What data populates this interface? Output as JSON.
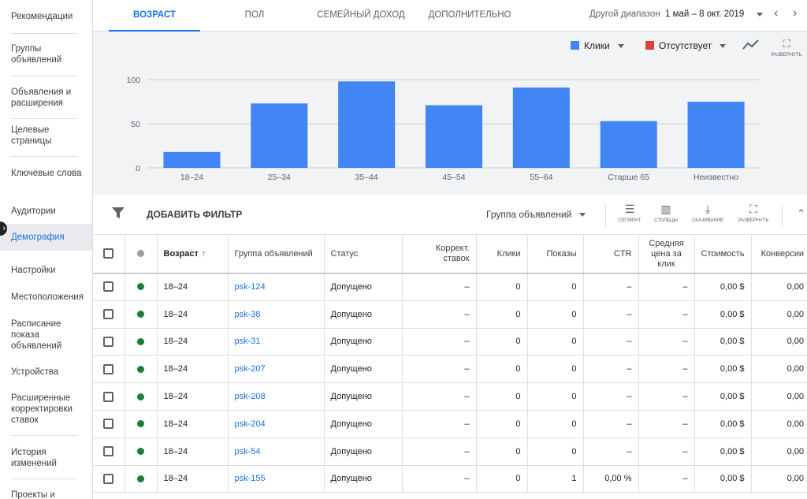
{
  "sidebar": {
    "items": [
      {
        "label": "Рекомендации"
      },
      {
        "label": "Группы объявлений"
      },
      {
        "label": "Объявления и расширения"
      },
      {
        "label": "Целевые страницы"
      },
      {
        "label": "Ключевые слова"
      },
      {
        "label": "Аудитории"
      },
      {
        "label": "Демография"
      },
      {
        "label": "Настройки"
      },
      {
        "label": "Местоположения"
      },
      {
        "label": "Расписание показа объявлений"
      },
      {
        "label": "Устройства"
      },
      {
        "label": "Расширенные корректировки ставок"
      },
      {
        "label": "История изменений"
      },
      {
        "label": "Проекты и"
      }
    ]
  },
  "tabs": [
    {
      "label": "ВОЗРАСТ"
    },
    {
      "label": "ПОЛ"
    },
    {
      "label": "СЕМЕЙНЫЙ ДОХОД"
    },
    {
      "label": "ДОПОЛНИТЕЛЬНО"
    }
  ],
  "date_range": {
    "label": "Другой диапазон",
    "value": "1 май – 8 окт. 2019"
  },
  "legend": {
    "metric1": {
      "label": "Клики",
      "color": "#4285f4"
    },
    "metric2": {
      "label": "Отсутствует",
      "color": "#db4437"
    }
  },
  "chart_actions": {
    "expand_label": "РАЗВЕРНУТЬ"
  },
  "chart_data": {
    "type": "bar",
    "categories": [
      "18–24",
      "25–34",
      "35–44",
      "45–54",
      "55–64",
      "Старше 65",
      "Неизвестно"
    ],
    "series": [
      {
        "name": "Клики",
        "values": [
          18,
          73,
          98,
          71,
          91,
          53,
          75
        ]
      }
    ],
    "yticks": [
      "0",
      "50",
      "100"
    ],
    "ylim": [
      0,
      100
    ],
    "grid": true,
    "color": "#4285f4"
  },
  "toolbar": {
    "add_filter": "ДОБАВИТЬ ФИЛЬТР",
    "group_select": "Группа объявлений",
    "segment": "СЕГМЕНТ",
    "columns": "СТОЛБЦЫ",
    "download": "СКАЧИВАНИЕ",
    "expand": "РАЗВЕРНУТЬ"
  },
  "table": {
    "headers": {
      "age": "Возраст",
      "ad_group": "Группа объявлений",
      "status": "Статус",
      "bid_adj": "Коррект. ставок",
      "clicks": "Клики",
      "impr": "Показы",
      "ctr": "CTR",
      "avg_cpc": "Средняя цена за клик",
      "cost": "Стоимость",
      "conv": "Конверсии"
    },
    "rows": [
      {
        "age": "18–24",
        "ad_group": "psk-124",
        "status": "Допущено",
        "bid_adj": "–",
        "clicks": "0",
        "impr": "0",
        "ctr": "–",
        "avg_cpc": "–",
        "cost": "0,00 $",
        "conv": "0,00"
      },
      {
        "age": "18–24",
        "ad_group": "psk-38",
        "status": "Допущено",
        "bid_adj": "–",
        "clicks": "0",
        "impr": "0",
        "ctr": "–",
        "avg_cpc": "–",
        "cost": "0,00 $",
        "conv": "0,00"
      },
      {
        "age": "18–24",
        "ad_group": "psk-31",
        "status": "Допущено",
        "bid_adj": "–",
        "clicks": "0",
        "impr": "0",
        "ctr": "–",
        "avg_cpc": "–",
        "cost": "0,00 $",
        "conv": "0,00"
      },
      {
        "age": "18–24",
        "ad_group": "psk-207",
        "status": "Допущено",
        "bid_adj": "–",
        "clicks": "0",
        "impr": "0",
        "ctr": "–",
        "avg_cpc": "–",
        "cost": "0,00 $",
        "conv": "0,00"
      },
      {
        "age": "18–24",
        "ad_group": "psk-208",
        "status": "Допущено",
        "bid_adj": "–",
        "clicks": "0",
        "impr": "0",
        "ctr": "–",
        "avg_cpc": "–",
        "cost": "0,00 $",
        "conv": "0,00"
      },
      {
        "age": "18–24",
        "ad_group": "psk-204",
        "status": "Допущено",
        "bid_adj": "–",
        "clicks": "0",
        "impr": "0",
        "ctr": "–",
        "avg_cpc": "–",
        "cost": "0,00 $",
        "conv": "0,00"
      },
      {
        "age": "18–24",
        "ad_group": "psk-54",
        "status": "Допущено",
        "bid_adj": "–",
        "clicks": "0",
        "impr": "0",
        "ctr": "–",
        "avg_cpc": "–",
        "cost": "0,00 $",
        "conv": "0,00"
      },
      {
        "age": "18–24",
        "ad_group": "psk-155",
        "status": "Допущено",
        "bid_adj": "–",
        "clicks": "0",
        "impr": "1",
        "ctr": "0,00 %",
        "avg_cpc": "–",
        "cost": "0,00 $",
        "conv": "0,00"
      }
    ]
  },
  "colors": {
    "status_green": "#188038",
    "status_grey": "#9aa0a6",
    "accent": "#1a73e8"
  }
}
